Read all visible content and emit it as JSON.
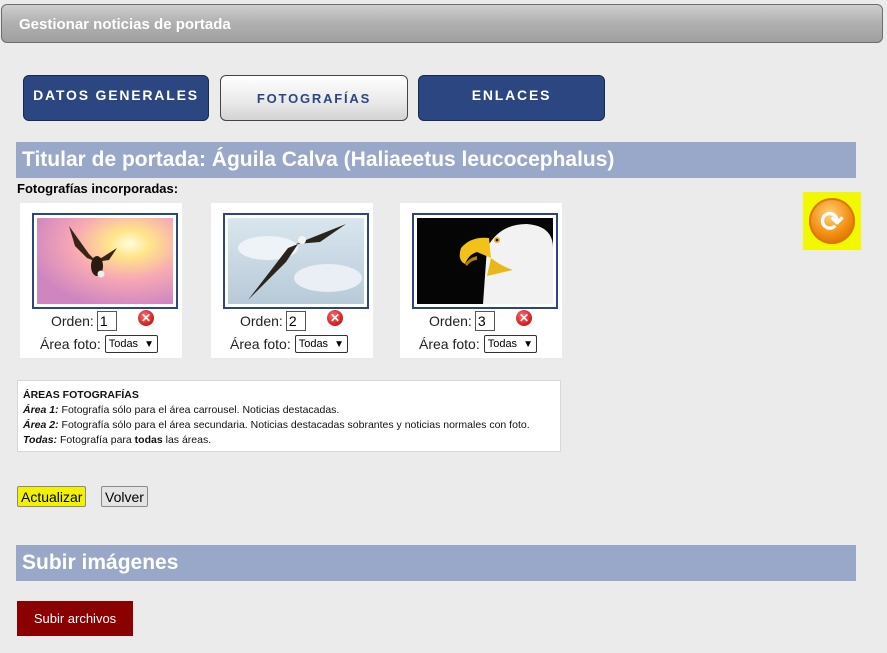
{
  "header": {
    "title": "Gestionar noticias de portada"
  },
  "tabs": [
    {
      "label": "DATOS GENERALES"
    },
    {
      "label": "FOTOGRAFÍAS"
    },
    {
      "label": "ENLACES"
    }
  ],
  "headline": "Titular de portada: Águila Calva (Haliaeetus leucocephalus)",
  "photos_label": "Fotografías incorporadas:",
  "photos": [
    {
      "order_label": "Orden:",
      "order": "1",
      "area_label": "Área foto:",
      "area": "Todas"
    },
    {
      "order_label": "Orden:",
      "order": "2",
      "area_label": "Área foto:",
      "area": "Todas"
    },
    {
      "order_label": "Orden:",
      "order": "3",
      "area_label": "Área foto:",
      "area": "Todas"
    }
  ],
  "areas_info": {
    "title": "ÁREAS FOTOGRAFÍAS",
    "area1_term": "Área 1:",
    "area1_text": " Fotografía sólo para el área carrousel. Noticias destacadas.",
    "area2_term": "Área 2:",
    "area2_text": " Fotografía sólo para el área secundaria. Noticias destacadas sobrantes y noticias normales con foto.",
    "todas_term": "Todas:",
    "todas_text_pre": " Fotografía para ",
    "todas_bold": "todas",
    "todas_text_post": " las áreas."
  },
  "buttons": {
    "update": "Actualizar",
    "back": "Volver"
  },
  "upload_section": {
    "title": "Subir imágenes",
    "button": "Subir archivos"
  },
  "icons": {
    "refresh": "refresh-icon",
    "delete": "delete-icon"
  },
  "colors": {
    "tab_blue": "#2c4681",
    "section_bar": "#99a8c8",
    "upload_red": "#8b0000",
    "highlight": "#f2f200"
  }
}
